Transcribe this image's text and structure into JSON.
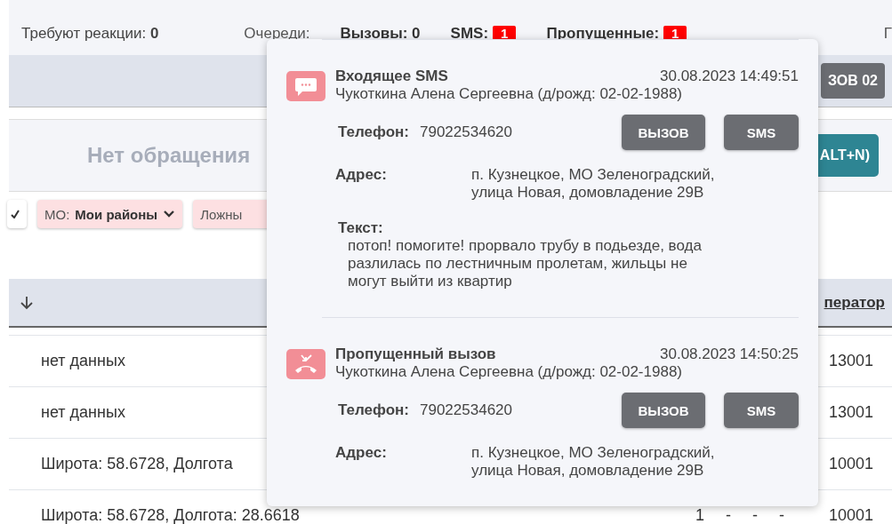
{
  "status_bar": {
    "attention_label": "Требуют реакции:",
    "attention_value": "0",
    "queues_label": "Очереди:",
    "queues": [
      {
        "label": "Вызовы:",
        "value": "0",
        "kind": "plain"
      },
      {
        "label": "SMS:",
        "value": "1",
        "kind": "badge"
      },
      {
        "label": "Пропущенные:",
        "value": "1",
        "kind": "badge"
      }
    ],
    "cut_text": "Г"
  },
  "toolbar": {
    "button": "ЗОВ 02"
  },
  "request_panel": {
    "empty_text": "Нет обращения",
    "button": "ALT+N)"
  },
  "filters": [
    {
      "kind": "check"
    },
    {
      "kind": "dropdown",
      "label": "МО:",
      "value": "Мои районы"
    },
    {
      "kind": "chip",
      "label": "Ложны"
    }
  ],
  "table": {
    "operator_header": "ператор",
    "rows": [
      {
        "address": "нет данных",
        "operator": "13001"
      },
      {
        "address": "нет данных",
        "operator": "13001"
      },
      {
        "address": "Широта: 58.6728, Долгота",
        "operator": "10001"
      },
      {
        "address": "Широта: 58.6728, Долгота: 28.6618",
        "marks": [
          "1",
          "-",
          "-",
          "-"
        ],
        "operator": "10001"
      }
    ]
  },
  "notifications": [
    {
      "kind": "sms",
      "title": "Входящее SMS",
      "time": "30.08.2023 14:49:51",
      "person": "Чукоткина Алена Сергеевна (д/рожд: 02-02-1988)",
      "phone_label": "Телефон:",
      "phone": "79022534620",
      "buttons": [
        "ВЫЗОВ",
        "SMS"
      ],
      "address_label": "Адрес:",
      "address_lines": [
        "п. Кузнецкое, МО Зеленоградский,",
        "улица Новая, домовладение 29В"
      ],
      "text_label": "Текст:",
      "text_lines": [
        "потоп! помогите! прорвало трубу в подьезде, вода",
        "разлилась по лестничным пролетам, жильцы не",
        "могут выйти из квартир"
      ]
    },
    {
      "kind": "missed",
      "title": "Пропущенный вызов",
      "time": "30.08.2023 14:50:25",
      "person": "Чукоткина Алена Сергеевна (д/рожд: 02-02-1988)",
      "phone_label": "Телефон:",
      "phone": "79022534620",
      "buttons": [
        "ВЫЗОВ",
        "SMS"
      ],
      "address_label": "Адрес:",
      "address_lines": [
        "п. Кузнецкое, МО Зеленоградский,",
        "улица Новая, домовладение 29В"
      ]
    }
  ]
}
